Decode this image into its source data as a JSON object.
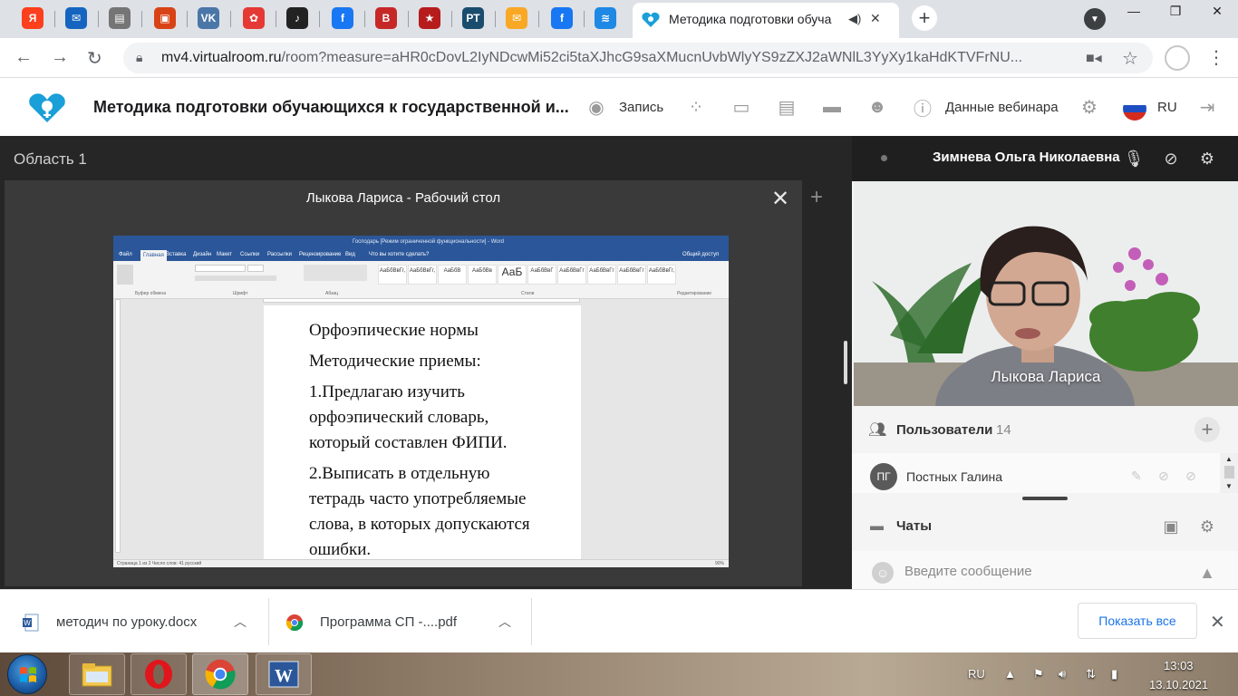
{
  "browser": {
    "tabs": [
      {
        "icon": "yandex-icon",
        "letter": "Я",
        "color": "#fc3f1d"
      },
      {
        "icon": "mail-icon",
        "letter": "✉",
        "color": "#1565c0"
      },
      {
        "icon": "document-icon",
        "letter": "▤",
        "color": "#757575"
      },
      {
        "icon": "image-icon",
        "letter": "▣",
        "color": "#d84315"
      },
      {
        "icon": "vk-icon",
        "letter": "VK",
        "color": "#4a76a8"
      },
      {
        "icon": "flower-icon",
        "letter": "✿",
        "color": "#e53935"
      },
      {
        "icon": "music-icon",
        "letter": "♪",
        "color": "#222222"
      },
      {
        "icon": "facebook-icon",
        "letter": "f",
        "color": "#1877f2"
      },
      {
        "icon": "book-icon",
        "letter": "B",
        "color": "#c62828"
      },
      {
        "icon": "star-badge-icon",
        "letter": "★",
        "color": "#b71c1c"
      },
      {
        "icon": "rt-icon",
        "letter": "РТ",
        "color": "#1a4c6e"
      },
      {
        "icon": "envelope-icon",
        "letter": "✉",
        "color": "#f9a825"
      },
      {
        "icon": "facebook-icon",
        "letter": "f",
        "color": "#1877f2"
      },
      {
        "icon": "landscape-icon",
        "letter": "≋",
        "color": "#1e88e5"
      }
    ],
    "active_tab_title": "Методика подготовки обуча",
    "url_host": "mv4.virtualroom.ru",
    "url_rest": "/room?measure=aHR0cDovL2IyNDcwMi52ci5taXJhcG9saXMucnUvbWlyYS9zZXJ2aWNlL3YyXy1kaHdKTVFrNU..."
  },
  "app": {
    "title": "Методика подготовки обучающихся к государственной и...",
    "record_label": "Запись",
    "webinar_data_label": "Данные вебинара",
    "language": "RU"
  },
  "main": {
    "area_title": "Область 1",
    "share_title": "Лыкова Лариса - Рабочий стол",
    "word": {
      "window_title": "Господарь [Режим ограниченной функциональности] - Word",
      "menu": [
        "Файл",
        "Главная",
        "Вставка",
        "Дизайн",
        "Макет",
        "Ссылки",
        "Рассылки",
        "Рецензирование",
        "Вид"
      ],
      "tell_me": "Что вы хотите сделать?",
      "share": "Общий доступ",
      "styles": [
        "АаБбВвГг,",
        "АаБбВвГг,",
        "АаБбВ",
        "АаБбВв",
        "АаБ",
        "АаБбВвГ",
        "АаБбВвГг",
        "АаБбВвГг",
        "АаБбВвГг",
        "АаБбВвГг,"
      ],
      "groups": [
        "Буфер обмена",
        "Шрифт",
        "Абзац",
        "Стили",
        "Редактирование"
      ],
      "status_left": "Страница 1 из 2   Число слов: 41   русский",
      "status_right": "90%",
      "lines": [
        "Орфоэпические  нормы",
        "Методические приемы:",
        "1.Предлагаю изучить",
        "орфоэпический словарь,",
        "который составлен ФИПИ.",
        "2.Выписать в отдельную",
        "тетрадь часто употребляемые",
        "слова, в которых допускаются",
        "ошибки."
      ]
    }
  },
  "sidebar": {
    "presenter_name": "Зимнева Ольга Николаевна",
    "video_label": "Лыкова Лариса",
    "users_title": "Пользователи",
    "users_count": "14",
    "user": {
      "initials": "ПГ",
      "name": "Постных Галина"
    },
    "chats_title": "Чаты",
    "message_placeholder": "Введите сообщение"
  },
  "downloads": {
    "items": [
      {
        "name": "методич по уроку.docx",
        "icon": "word-doc-icon"
      },
      {
        "name": "Программа СП -....pdf",
        "icon": "chrome-icon"
      }
    ],
    "show_all_label": "Показать все"
  },
  "taskbar": {
    "apps": [
      "file-explorer-icon",
      "opera-icon",
      "chrome-icon",
      "word-icon"
    ],
    "language": "RU",
    "time": "13:03",
    "date": "13.10.2021"
  },
  "colors": {
    "brand": "#1a9fd8",
    "word_blue": "#2b579a",
    "chrome_blue": "#1a73e8",
    "dark_bg": "#262626"
  }
}
